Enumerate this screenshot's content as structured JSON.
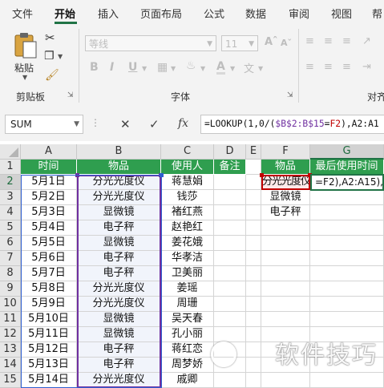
{
  "ribbon_tabs": [
    "文件",
    "开始",
    "插入",
    "页面布局",
    "公式",
    "数据",
    "审阅",
    "视图",
    "帮"
  ],
  "active_tab": "开始",
  "clipboard": {
    "paste_label": "粘贴",
    "group_label": "剪贴板"
  },
  "font": {
    "name": "等线",
    "size": "11",
    "group_label": "字体",
    "bold": "B",
    "italic": "I",
    "underline": "U"
  },
  "next_group_label": "对齐",
  "formula_bar": {
    "name_box": "SUM",
    "fx": "fx",
    "formula_part1": "=LOOKUP(1,0/(",
    "formula_ref1": "$B$2:B$15",
    "formula_part2": "=",
    "formula_ref2": "F2",
    "formula_part3": "),A2:A1"
  },
  "columns": [
    "A",
    "B",
    "C",
    "D",
    "E",
    "F",
    "G"
  ],
  "rows": [
    "1",
    "2",
    "3",
    "4",
    "5",
    "6",
    "7",
    "8",
    "9",
    "10",
    "11",
    "12",
    "13",
    "14",
    "15"
  ],
  "table_headers": [
    "时间",
    "物品",
    "使用人",
    "备注"
  ],
  "table_rows": [
    [
      "5月1日",
      "分光光度仪",
      "蒋慧娟",
      ""
    ],
    [
      "5月2日",
      "分光光度仪",
      "钱莎",
      ""
    ],
    [
      "5月3日",
      "显微镜",
      "褚红燕",
      ""
    ],
    [
      "5月4日",
      "电子秤",
      "赵艳红",
      ""
    ],
    [
      "5月5日",
      "显微镜",
      "姜花娥",
      ""
    ],
    [
      "5月6日",
      "电子秤",
      "华孝洁",
      ""
    ],
    [
      "5月7日",
      "电子秤",
      "卫美丽",
      ""
    ],
    [
      "5月8日",
      "分光光度仪",
      "姜瑶",
      ""
    ],
    [
      "5月9日",
      "分光光度仪",
      "周珊",
      ""
    ],
    [
      "5月10日",
      "显微镜",
      "吴天春",
      ""
    ],
    [
      "5月11日",
      "显微镜",
      "孔小丽",
      ""
    ],
    [
      "5月12日",
      "电子秤",
      "蒋红恋",
      ""
    ],
    [
      "5月13日",
      "电子秤",
      "周梦娇",
      ""
    ],
    [
      "5月14日",
      "分光光度仪",
      "戚卿",
      ""
    ]
  ],
  "lookup_headers": [
    "物品",
    "最后使用时间"
  ],
  "lookup_items": [
    "分光光度仪",
    "显微镜",
    "电子秤"
  ],
  "f2_display": "分光光度仪",
  "editing_text": "=F2),A2:A15),",
  "watermark": "软件技巧",
  "colors": {
    "excel_green": "#217346",
    "header_green": "#2f9e4f",
    "ref_purple": "#7030a0",
    "ref_red": "#c00000",
    "ref_blue": "#2e5fd0"
  }
}
